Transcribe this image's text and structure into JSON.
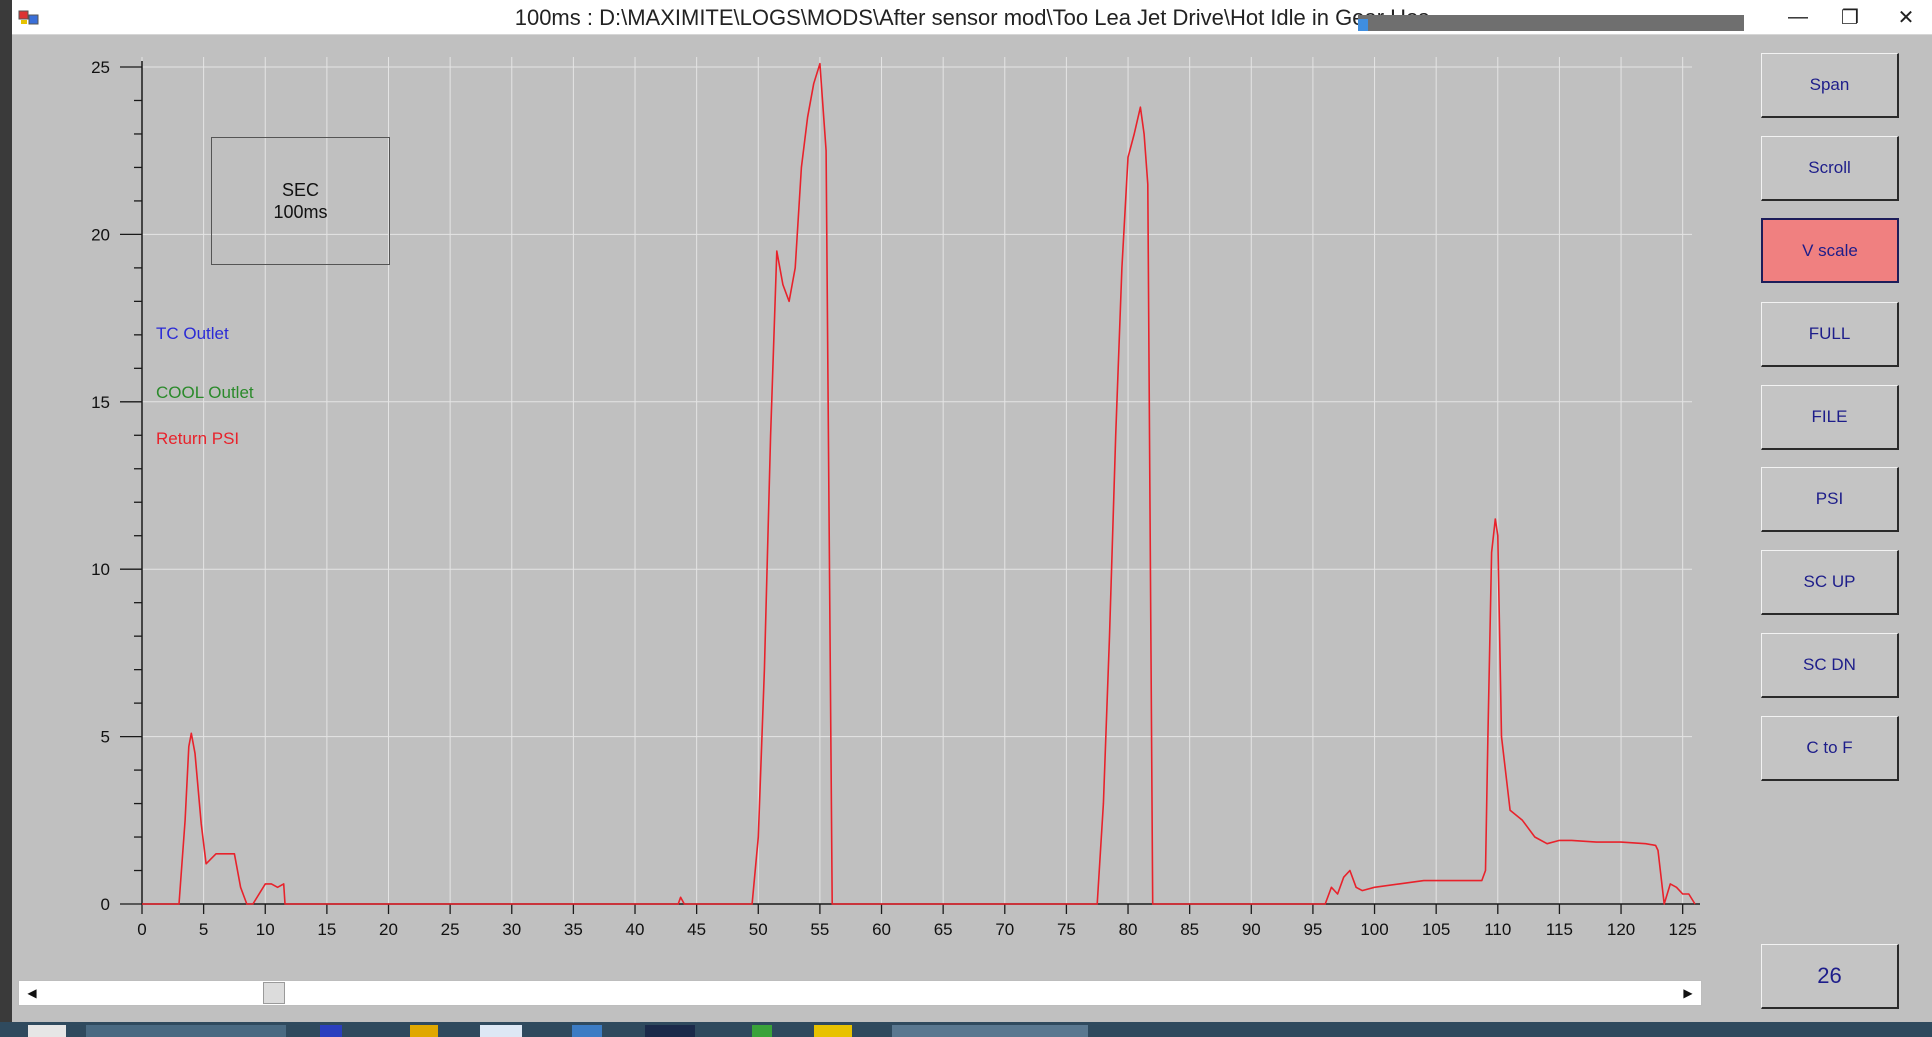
{
  "window": {
    "title": "100ms : D:\\MAXIMITE\\LOGS\\MODS\\After sensor mod\\Too Lea Jet Drive\\Hot Idle in Gear Hos",
    "controls": {
      "minimize": "—",
      "restore": "❐",
      "close": "✕"
    }
  },
  "legend": {
    "box_line1": "SEC",
    "box_line2": "100ms",
    "items": [
      {
        "label": "TC Outlet",
        "color": "#2a2ad6"
      },
      {
        "label": "COOL Outlet",
        "color": "#2b8a2b"
      },
      {
        "label": "Return PSI",
        "color": "#e8222b"
      }
    ]
  },
  "buttons": [
    "Span",
    "Scroll",
    "V scale",
    "FULL",
    "FILE",
    "PSI",
    "SC UP",
    "SC DN",
    "C to F"
  ],
  "active_button": "V scale",
  "counter": "26",
  "scrollbar": {
    "left_arrow": "◀",
    "right_arrow": "▶"
  },
  "colors": {
    "active_button": "#f08080",
    "button_text": "#1d1d8a"
  },
  "chart_data": {
    "type": "line",
    "xlim": [
      0,
      126
    ],
    "ylim": [
      0,
      25
    ],
    "x_ticks": [
      0,
      5,
      10,
      15,
      20,
      25,
      30,
      35,
      40,
      45,
      50,
      55,
      60,
      65,
      70,
      75,
      80,
      85,
      90,
      95,
      100,
      105,
      110,
      115,
      120,
      125
    ],
    "y_ticks": [
      0,
      5,
      10,
      15,
      20,
      25
    ],
    "grid": true,
    "series": [
      {
        "name": "Return PSI",
        "color": "#e8222b",
        "x": [
          0,
          3,
          3.5,
          3.8,
          4,
          4.3,
          4.8,
          5.2,
          6,
          7,
          7.5,
          8,
          8.5,
          9,
          10,
          10.5,
          11,
          11.5,
          11.6,
          12,
          43.5,
          43.7,
          44,
          49.5,
          50,
          50.5,
          51,
          51.5,
          52,
          52.5,
          53,
          53.5,
          54,
          54.5,
          55,
          55.5,
          56,
          56.5,
          57,
          77.5,
          78,
          78.5,
          79,
          79.5,
          80,
          80.5,
          81,
          81.3,
          81.6,
          82,
          82.5,
          83,
          96,
          96.5,
          97,
          97.5,
          98,
          98.5,
          99,
          100,
          102,
          104,
          106,
          108,
          108.7,
          109,
          109.2,
          109.5,
          109.8,
          110,
          110.3,
          111,
          112,
          113,
          114,
          115,
          116,
          118,
          120,
          122,
          122.8,
          123,
          123.5,
          124,
          124.5,
          125,
          125.5,
          126
        ],
        "y": [
          0,
          0,
          2.5,
          4.7,
          5.1,
          4.5,
          2.4,
          1.2,
          1.5,
          1.5,
          1.5,
          0.5,
          0,
          0,
          0.6,
          0.6,
          0.5,
          0.6,
          0,
          0,
          0,
          0.2,
          0,
          0,
          2,
          7,
          14,
          19.5,
          18.5,
          18,
          19,
          22,
          23.5,
          24.5,
          25.1,
          22.5,
          0,
          0,
          0,
          0,
          3,
          8,
          14,
          19,
          22.3,
          23,
          23.8,
          23,
          21.5,
          0,
          0,
          0,
          0,
          0.5,
          0.3,
          0.8,
          1,
          0.5,
          0.4,
          0.5,
          0.6,
          0.7,
          0.7,
          0.7,
          0.7,
          1,
          5,
          10.5,
          11.5,
          11,
          5,
          2.8,
          2.5,
          2,
          1.8,
          1.9,
          1.9,
          1.85,
          1.85,
          1.8,
          1.75,
          1.6,
          0,
          0.6,
          0.5,
          0.3,
          0.3,
          0
        ]
      }
    ]
  }
}
